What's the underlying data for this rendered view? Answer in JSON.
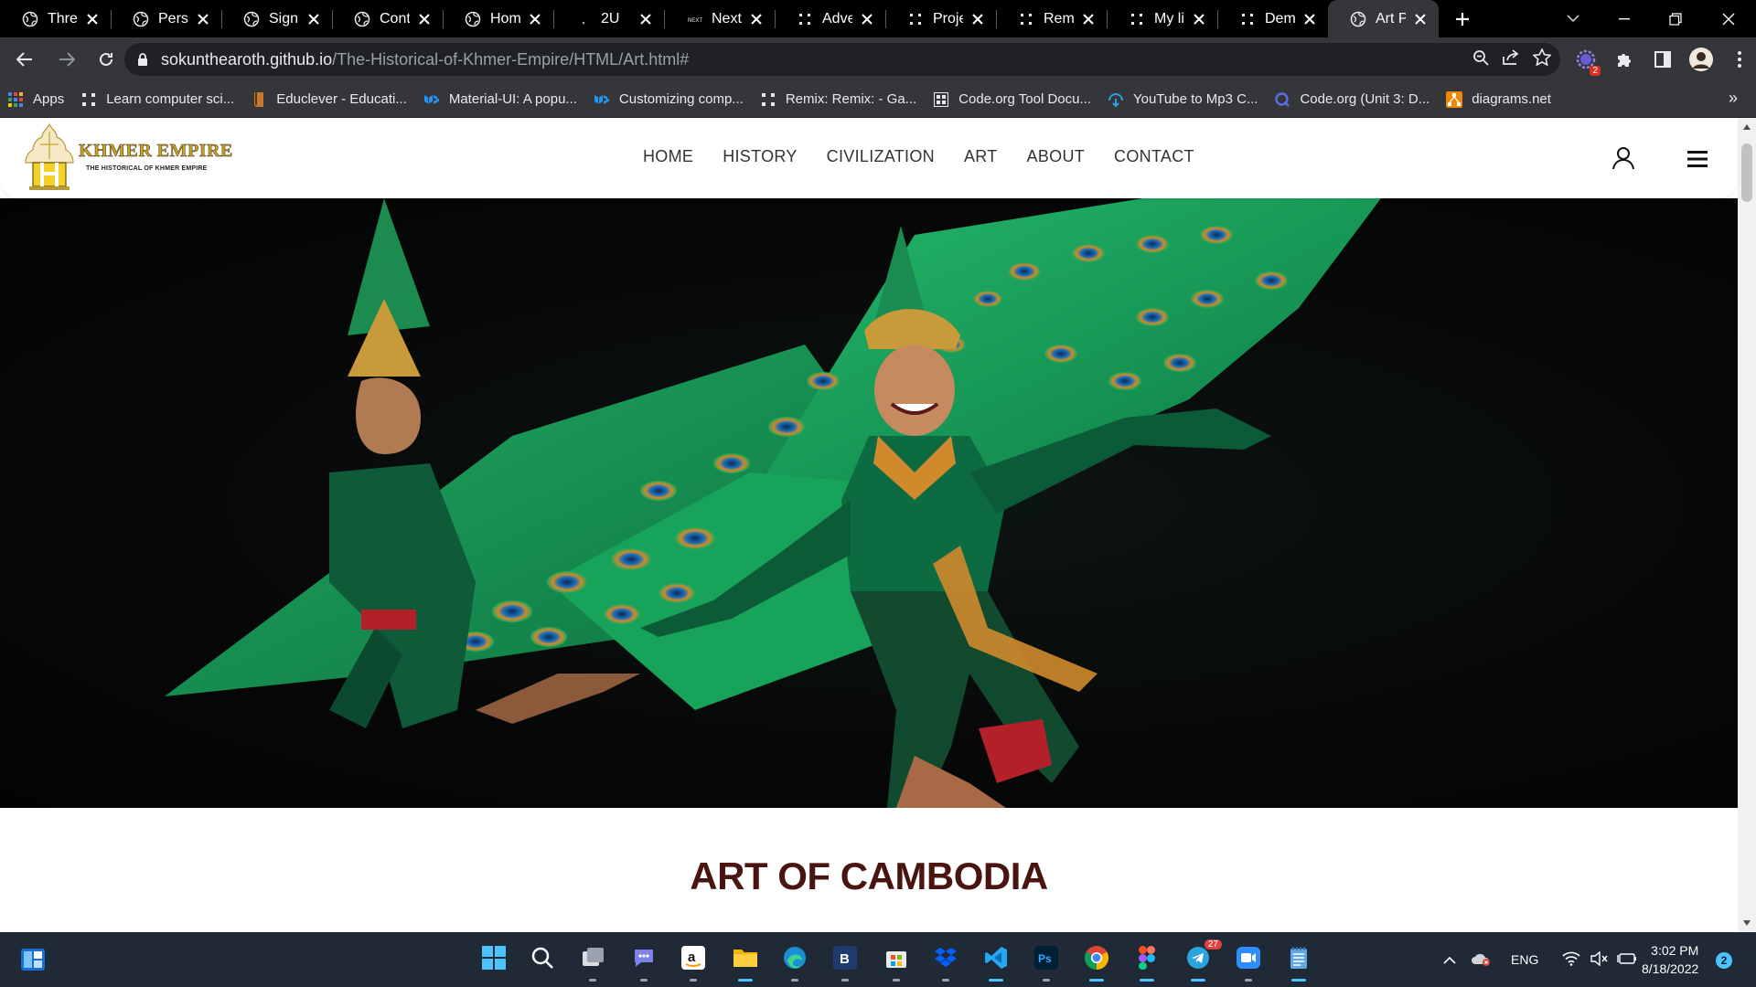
{
  "browser": {
    "tabs": [
      {
        "title": "Three",
        "favicon": "globe-icon",
        "active": false
      },
      {
        "title": "Person",
        "favicon": "globe-icon",
        "active": false
      },
      {
        "title": "Sign U",
        "favicon": "globe-icon",
        "active": false
      },
      {
        "title": "Conta",
        "favicon": "globe-icon",
        "active": false
      },
      {
        "title": "Home",
        "favicon": "globe-icon",
        "active": false
      },
      {
        "title": "2U",
        "favicon": "dot-icon",
        "active": false
      },
      {
        "title": "Next S",
        "favicon": "next-icon",
        "active": false
      },
      {
        "title": "Adven",
        "favicon": "dots-grid-icon",
        "active": false
      },
      {
        "title": "Projec",
        "favicon": "dots-grid-icon",
        "active": false
      },
      {
        "title": "Remix",
        "favicon": "dots-grid-icon",
        "active": false
      },
      {
        "title": "My litt",
        "favicon": "dots-grid-icon",
        "active": false
      },
      {
        "title": "Demo",
        "favicon": "dots-grid-icon",
        "active": false
      },
      {
        "title": "Art Pa",
        "favicon": "globe-icon",
        "active": true
      }
    ],
    "address": {
      "domain": "sokunthearoth.github.io",
      "path": "/The-Historical-of-Khmer-Empire/HTML/Art.html#"
    },
    "extension_badge": "2",
    "bookmarks": [
      {
        "label": "Apps",
        "icon": "apps-grid-icon",
        "color": "#4285f4"
      },
      {
        "label": "Learn computer sci...",
        "icon": "dots-grid-icon",
        "color": "#e8eaed"
      },
      {
        "label": "Educlever - Educati...",
        "icon": "book-icon",
        "color": "#c47a2c"
      },
      {
        "label": "Material-UI: A popu...",
        "icon": "mui-icon",
        "color": "#2196f3"
      },
      {
        "label": "Customizing comp...",
        "icon": "mui-icon",
        "color": "#2196f3"
      },
      {
        "label": "Remix: Remix: - Ga...",
        "icon": "dots-grid-icon",
        "color": "#e8eaed"
      },
      {
        "label": "Code.org Tool Docu...",
        "icon": "codeorg-icon",
        "color": "#e8eaed"
      },
      {
        "label": "YouTube to Mp3 C...",
        "icon": "mp3-icon",
        "color": "#29a0e0"
      },
      {
        "label": "Code.org (Unit 3: D...",
        "icon": "q-icon",
        "color": "#5b6ee8"
      },
      {
        "label": "diagrams.net",
        "icon": "diagrams-icon",
        "color": "#f08705"
      }
    ],
    "bookmarks_more": "»"
  },
  "site": {
    "brand_name": "KHMER EMPIRE",
    "brand_tagline": "THE HISTORICAL OF KHMER EMPIRE",
    "nav": [
      "HOME",
      "HISTORY",
      "CIVILIZATION",
      "ART",
      "ABOUT",
      "CONTACT"
    ],
    "hero_alt": "Khmer peacock dance performers in green costumes",
    "section_title": "ART OF CAMBODIA"
  },
  "taskbar": {
    "apps": [
      {
        "name": "windows-start-icon",
        "running": false
      },
      {
        "name": "search-icon",
        "running": false
      },
      {
        "name": "task-view-icon",
        "running": false
      },
      {
        "name": "teams-chat-icon",
        "running": false
      },
      {
        "name": "amazon-icon",
        "running": false
      },
      {
        "name": "file-explorer-icon",
        "running": true
      },
      {
        "name": "edge-icon",
        "running": false
      },
      {
        "name": "b-app-icon",
        "running": false
      },
      {
        "name": "store-icon",
        "running": false
      },
      {
        "name": "dropbox-icon",
        "running": false
      },
      {
        "name": "vscode-icon",
        "running": true
      },
      {
        "name": "photoshop-icon",
        "running": false
      },
      {
        "name": "chrome-icon",
        "running": true
      },
      {
        "name": "figma-icon",
        "running": true
      },
      {
        "name": "telegram-icon",
        "running": true
      },
      {
        "name": "zoom-icon",
        "running": false
      },
      {
        "name": "notepad-icon",
        "running": true
      }
    ],
    "telegram_badge": "27",
    "language": "ENG",
    "time": "3:02 PM",
    "date": "8/18/2022",
    "notifications": "2"
  }
}
